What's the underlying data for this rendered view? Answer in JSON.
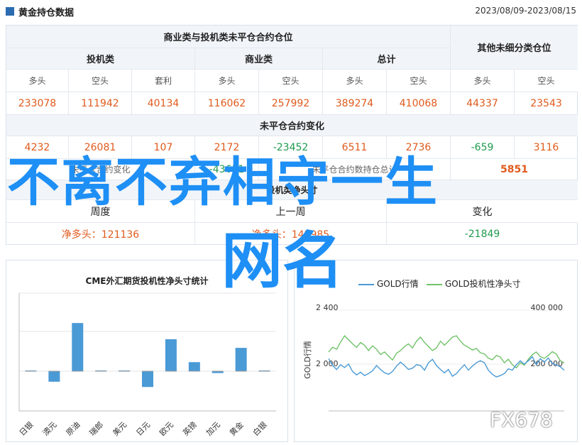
{
  "header": {
    "title": "黄金持仓数据",
    "date_range": "2023/08/09-2023/08/15"
  },
  "table": {
    "group1_title": "商业类与投机类未平仓合约仓位",
    "group2_title": "其他未细分类仓位",
    "sections": [
      "投机类",
      "商业类",
      "总计"
    ],
    "subheaders": [
      "多头",
      "空头",
      "套利",
      "多头",
      "空头",
      "多头",
      "空头",
      "多头",
      "空头"
    ],
    "row1": [
      "233078",
      "111942",
      "40134",
      "116062",
      "257992",
      "389274",
      "410068",
      "44337",
      "23543"
    ],
    "change_title": "未平仓合约变化",
    "row2": [
      "4232",
      "26081",
      "107",
      "2172",
      "-23452",
      "6511",
      "2736",
      "-659",
      "3116"
    ],
    "row3_left": "未平仓合约变化",
    "row3_mid": "未平仓合约数持仓总计",
    "row3_big": "-43611",
    "row3_right": "5851",
    "net_title": "投机类净头寸",
    "net_cols": [
      "周度",
      "上一周",
      "变化"
    ],
    "net_vals": [
      "净多头：121136",
      "净多头：142985",
      "-21849"
    ]
  },
  "chart_left": {
    "title": "CME外汇期货投机性净头寸统计"
  },
  "chart_right": {
    "legend_gold": "GOLD行情",
    "legend_net": "GOLD投机性净头寸",
    "y_left_label": "GOLD行情",
    "y_left_ticks": [
      "2 400",
      "2 000"
    ],
    "y_right_ticks": [
      "400 000",
      "200 000"
    ]
  },
  "watermark": {
    "line1": "不离不弃相守一生",
    "line2": "网名",
    "brand": "FX678"
  },
  "colors": {
    "accent": "#2b6cb0",
    "positive": "#e05a1c",
    "negative": "#1f9a4d",
    "bar": "#4a9ad6",
    "gold_line": "#4a9ad6",
    "net_line": "#72c26a"
  },
  "chart_data": [
    {
      "type": "bar",
      "title": "CME外汇期货投机性净头寸统计",
      "categories": [
        "日银",
        "澳元",
        "原油",
        "瑞郎",
        "美元",
        "日元",
        "欧元",
        "英镑",
        "加元",
        "黄金",
        "白银"
      ],
      "values": [
        1,
        -28,
        128,
        0,
        0,
        -42,
        85,
        24,
        -5,
        62,
        0
      ]
    },
    {
      "type": "line",
      "series": [
        {
          "name": "GOLD行情",
          "values": [
            2040,
            1990,
            1960,
            1995,
            1975,
            2000,
            1945,
            1920,
            1940,
            1915,
            1930,
            1950,
            1990,
            1960,
            1935,
            1925,
            1945,
            1985,
            2015,
            1990,
            1960,
            1970,
            1995,
            1990,
            1955,
            2010,
            2035,
            1990,
            1960,
            1935,
            1960,
            1910,
            1930,
            1965,
            1995,
            1955,
            1985,
            2010,
            2025,
            2010,
            1955,
            1925,
            1905,
            1915,
            1930,
            1965,
            1955,
            1995,
            2025,
            2000,
            2025,
            2055,
            1995,
            2040,
            2015,
            2045,
            2005,
            1995,
            1980,
            1955
          ]
        },
        {
          "name": "GOLD投机性净头寸",
          "values": [
            245000,
            262000,
            255000,
            282000,
            305000,
            290000,
            275000,
            262000,
            280000,
            270000,
            250000,
            268000,
            255000,
            235000,
            245000,
            230000,
            215000,
            240000,
            250000,
            265000,
            275000,
            260000,
            285000,
            300000,
            280000,
            265000,
            250000,
            260000,
            285000,
            270000,
            285000,
            300000,
            305000,
            285000,
            270000,
            262000,
            252000,
            258000,
            242000,
            238000,
            222000,
            216000,
            232000,
            226000,
            205000,
            218000,
            198000,
            186000,
            205000,
            196000,
            218000,
            235000,
            245000,
            228000,
            221000,
            232000,
            246000,
            238000,
            212000,
            204000
          ]
        }
      ]
    }
  ]
}
